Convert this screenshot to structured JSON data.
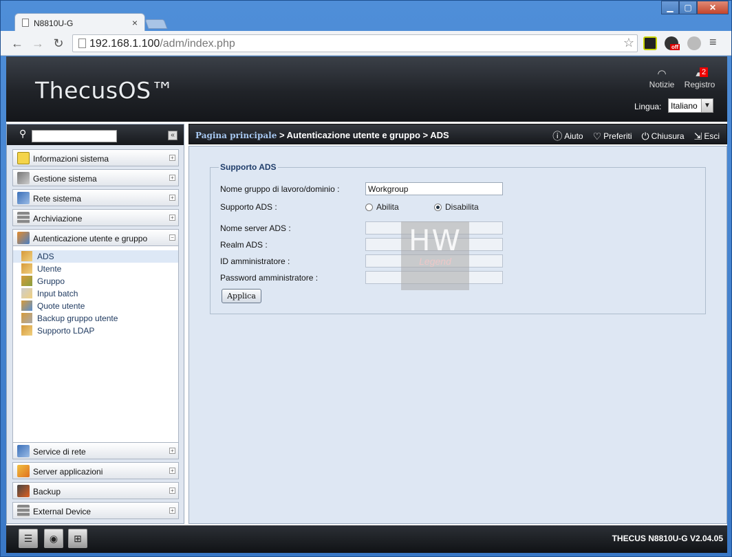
{
  "browser": {
    "tab_title": "N8810U-G",
    "tab_close": "×",
    "url_host": "192.168.1.100",
    "url_path": "/adm/index.php",
    "ext_off_badge": "off"
  },
  "header": {
    "logo": "ThecusOS™",
    "notice_label": "Notizie",
    "log_label": "Registro",
    "log_count": "2",
    "language_label": "Lingua:",
    "language_value": "Italiano"
  },
  "sidebar": {
    "menu_top": [
      {
        "label": "Informazioni sistema",
        "toggle": "+"
      },
      {
        "label": "Gestione sistema",
        "toggle": "+"
      },
      {
        "label": "Rete sistema",
        "toggle": "+"
      },
      {
        "label": "Archiviazione",
        "toggle": "+"
      },
      {
        "label": "Autenticazione utente e gruppo",
        "toggle": "−"
      }
    ],
    "submenu": [
      {
        "label": "ADS"
      },
      {
        "label": "Utente"
      },
      {
        "label": "Gruppo"
      },
      {
        "label": "Input batch"
      },
      {
        "label": "Quote utente"
      },
      {
        "label": "Backup gruppo utente"
      },
      {
        "label": "Supporto LDAP"
      }
    ],
    "menu_bottom": [
      {
        "label": "Service di rete",
        "toggle": "+"
      },
      {
        "label": "Server applicazioni",
        "toggle": "+"
      },
      {
        "label": "Backup",
        "toggle": "+"
      },
      {
        "label": "External Device",
        "toggle": "+"
      }
    ]
  },
  "breadcrumb": {
    "home": "Pagina principale",
    "path": " > Autenticazione utente e gruppo > ADS"
  },
  "tools": {
    "help": "Aiuto",
    "favorites": "Preferiti",
    "shutdown": "Chiusura",
    "logout": "Esci"
  },
  "form": {
    "legend": "Supporto ADS",
    "workgroup_label": "Nome gruppo di lavoro/dominio :",
    "workgroup_value": "Workgroup",
    "ads_support_label": "Supporto ADS :",
    "enable_label": "Abilita",
    "disable_label": "Disabilita",
    "server_label": "Nome server ADS :",
    "realm_label": "Realm ADS :",
    "admin_id_label": "ID amministratore :",
    "admin_pw_label": "Password amministratore :",
    "apply_label": "Applica"
  },
  "watermark": {
    "big": "HW",
    "small": "Legend"
  },
  "footer": {
    "version": "THECUS N8810U-G V2.04.05"
  },
  "colors": {
    "accent": "#a8c9f2",
    "panel_bg": "#dee7f3",
    "badge": "#e00000"
  }
}
